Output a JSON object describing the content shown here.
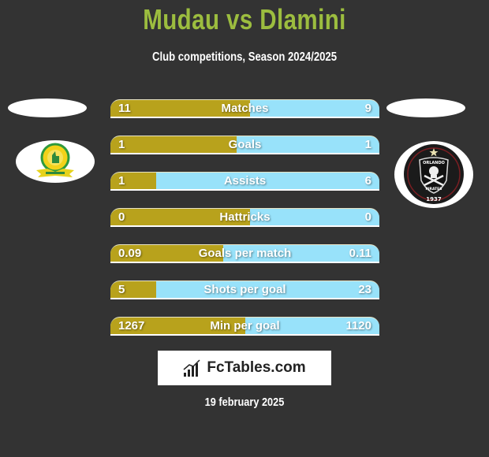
{
  "header": {
    "title": "Mudau vs Dlamini",
    "subtitle": "Club competitions, Season 2024/2025"
  },
  "colors": {
    "background": "#333333",
    "title": "#9cbd3f",
    "left_bar": "#b8a21c",
    "right_bar": "#98e2fa"
  },
  "teams": {
    "left": {
      "logo_icon": "mamelodi-sundowns-crest-icon"
    },
    "right": {
      "logo_icon": "orlando-pirates-crest-icon",
      "logo_text_top": "ORLANDO",
      "logo_text_bottom": "PIRATES",
      "logo_year": "1937"
    }
  },
  "stats": [
    {
      "label": "Matches",
      "left": "11",
      "right": "9",
      "left_share": 0.52
    },
    {
      "label": "Goals",
      "left": "1",
      "right": "1",
      "left_share": 0.47
    },
    {
      "label": "Assists",
      "left": "1",
      "right": "6",
      "left_share": 0.17
    },
    {
      "label": "Hattricks",
      "left": "0",
      "right": "0",
      "left_share": 0.52
    },
    {
      "label": "Goals per match",
      "left": "0.09",
      "right": "0.11",
      "left_share": 0.42
    },
    {
      "label": "Shots per goal",
      "left": "5",
      "right": "23",
      "left_share": 0.17
    },
    {
      "label": "Min per goal",
      "left": "1267",
      "right": "1120",
      "left_share": 0.5
    }
  ],
  "footer": {
    "brand": "FcTables.com",
    "brand_icon": "bar-chart-icon",
    "date": "19 february 2025"
  }
}
